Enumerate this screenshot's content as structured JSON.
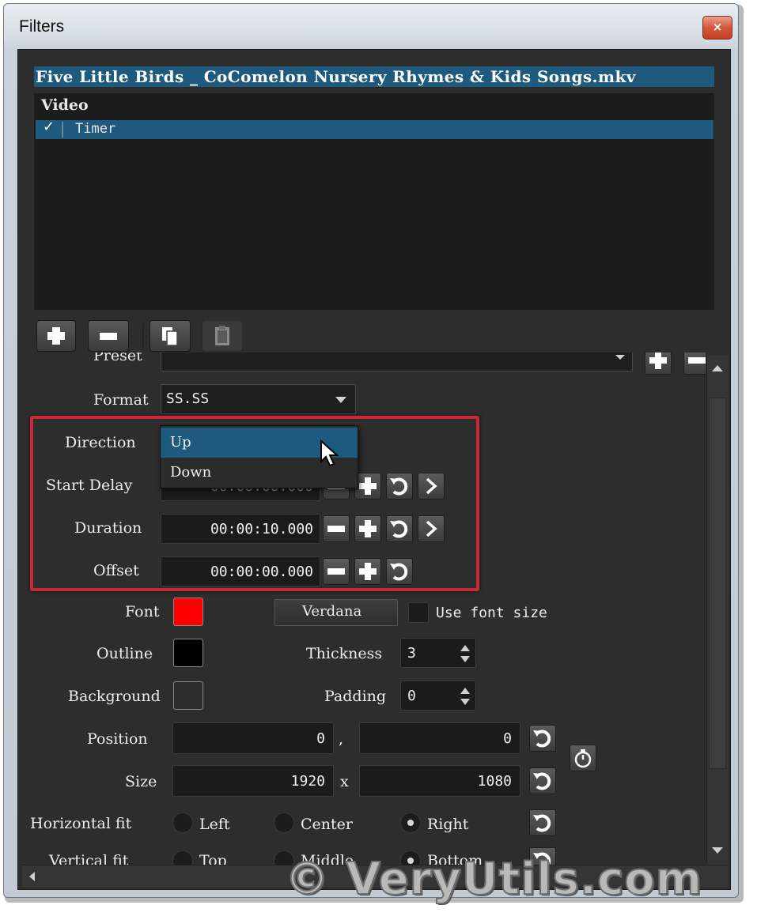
{
  "window": {
    "title": "Filters",
    "close_symbol": "×"
  },
  "file_title": "Five Little Birds _ CoComelon Nursery Rhymes & Kids Songs.mkv",
  "filter_list": {
    "category": "Video",
    "items": [
      {
        "label": "Timer",
        "checked": true,
        "check_mark": "✓"
      }
    ]
  },
  "properties": {
    "preset_label": "Preset",
    "format_label": "Format",
    "format_value": "SS.SS",
    "direction_label": "Direction",
    "direction_options": [
      "Up",
      "Down"
    ],
    "direction_selected": "Up",
    "start_delay_label": "Start Delay",
    "start_delay_value": "00:00:00.000",
    "duration_label": "Duration",
    "duration_value": "00:00:10.000",
    "offset_label": "Offset",
    "offset_value": "00:00:00.000",
    "font_label": "Font",
    "font_color": "#ff0000",
    "font_name": "Verdana",
    "use_font_size_label": "Use font size",
    "outline_label": "Outline",
    "outline_color": "#000000",
    "thickness_label": "Thickness",
    "thickness_value": "3",
    "background_label": "Background",
    "background_color": "#2d2d2d",
    "padding_label": "Padding",
    "padding_value": "0",
    "position_label": "Position",
    "position_x": "0",
    "position_sep": ",",
    "position_y": "0",
    "size_label": "Size",
    "size_w": "1920",
    "size_sep": "x",
    "size_h": "1080",
    "hfit_label": "Horizontal fit",
    "hfit_options": [
      "Left",
      "Center",
      "Right"
    ],
    "hfit_selected": "Right",
    "vfit_label": "Vertical fit",
    "vfit_options": [
      "Top",
      "Middle",
      "Bottom"
    ],
    "vfit_selected": "Bottom"
  },
  "watermark": "© VeryUtils.com",
  "colors": {
    "accent": "#1d5a7d",
    "highlight_border": "#c8283a",
    "panel": "#2d2d2d"
  }
}
